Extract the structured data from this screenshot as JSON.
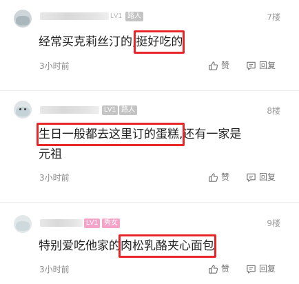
{
  "comments": [
    {
      "level_badge": "LV1",
      "role_badge": "路人",
      "floor": "7楼",
      "text_lines": [
        {
          "before": "经常买克莉丝汀的,",
          "highlight": "挺好吃的",
          "after": ""
        }
      ],
      "time": "3小时前",
      "like_label": "赞",
      "reply_label": "回复"
    },
    {
      "level_badge": "LV1",
      "role_badge": "路人",
      "floor": "8楼",
      "text_lines": [
        {
          "before": "",
          "highlight": "生日一般都去这里订的蛋糕,",
          "after": "还有一家是"
        },
        {
          "before": "元祖",
          "highlight": "",
          "after": ""
        }
      ],
      "time": "3小时前",
      "like_label": "赞",
      "reply_label": "回复"
    },
    {
      "level_badge": "LV1",
      "role_badge": "秀女",
      "floor": "9楼",
      "text_lines": [
        {
          "before": "特别爱吃他家的",
          "highlight": "肉松乳酪夹心面包",
          "after": ""
        }
      ],
      "time": "3小时前",
      "like_label": "赞",
      "reply_label": "回复"
    }
  ],
  "icons": {
    "like": "thumbs-up-icon",
    "reply": "comment-bubble-icon"
  },
  "colors": {
    "highlight_box": "#e8262a",
    "badge_gray": "#c4c4c4",
    "badge_pink": "#f5a3c8"
  }
}
